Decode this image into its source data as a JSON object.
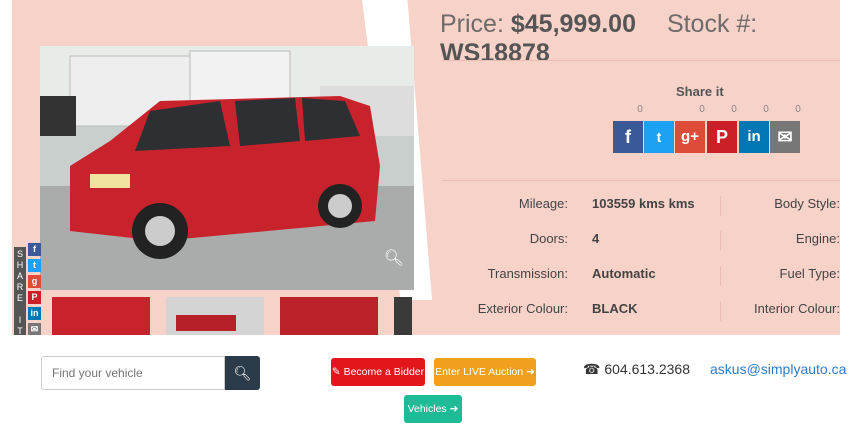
{
  "price": {
    "label": "Price:",
    "value": "$45,999.00"
  },
  "stock": {
    "label": "Stock #:",
    "value": "WS18878"
  },
  "share": {
    "title": "Share it",
    "counts": [
      "0",
      "0",
      "0",
      "0",
      "0"
    ],
    "vertical_letters": "SHARE IT",
    "buttons": [
      {
        "icon": "facebook-icon",
        "glyph": "f",
        "color": "#3b5998"
      },
      {
        "icon": "twitter-icon",
        "glyph": "t",
        "color": "#1da1f2"
      },
      {
        "icon": "google-plus-icon",
        "glyph": "g+",
        "color": "#dd4b39"
      },
      {
        "icon": "pinterest-icon",
        "glyph": "P",
        "color": "#cb2027"
      },
      {
        "icon": "linkedin-icon",
        "glyph": "in",
        "color": "#0077b5"
      },
      {
        "icon": "email-icon",
        "glyph": "✉",
        "color": "#777777"
      }
    ]
  },
  "specs": [
    {
      "label": "Mileage:",
      "value": "103559 kms kms",
      "right_label": "Body Style:"
    },
    {
      "label": "Doors:",
      "value": "4",
      "right_label": "Engine:"
    },
    {
      "label": "Transmission:",
      "value": "Automatic",
      "right_label": "Fuel Type:"
    },
    {
      "label": "Exterior Colour:",
      "value": "BLACK",
      "right_label": "Interior Colour:"
    }
  ],
  "search": {
    "placeholder": "Find your vehicle"
  },
  "buttons": {
    "become_bidder": "Become a Bidder",
    "live_auction": "Enter LIVE Auction",
    "vehicles": "Vehicles"
  },
  "contact": {
    "phone": "604.613.2368",
    "email": "askus@simplyauto.ca"
  },
  "colors": {
    "panel": "#f7d2c9",
    "red_button": "#e3161b",
    "orange_button": "#f0a01c",
    "teal_button": "#1fbb97",
    "search_button": "#2c3b4a"
  }
}
